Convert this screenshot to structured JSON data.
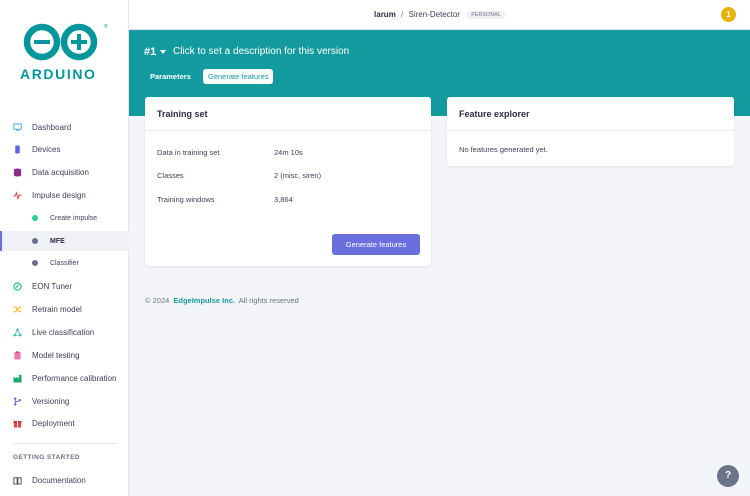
{
  "brand": {
    "wordmark": "ARDUINO",
    "reg": "®",
    "color": "#00979c"
  },
  "topbar": {
    "user": "larum",
    "separator": "/",
    "project": "Siren-Detector",
    "badge": "PERSONAL",
    "notification_count": "1"
  },
  "sidebar": {
    "items": [
      {
        "label": "Dashboard",
        "icon": "monitor-icon"
      },
      {
        "label": "Devices",
        "icon": "device-icon"
      },
      {
        "label": "Data acquisition",
        "icon": "database-icon"
      },
      {
        "label": "Impulse design",
        "icon": "pulse-icon"
      },
      {
        "label": "Create impulse",
        "icon": "dot-icon"
      },
      {
        "label": "MFE",
        "icon": "dot-icon",
        "active": true
      },
      {
        "label": "Classifier",
        "icon": "dot-icon"
      },
      {
        "label": "EON Tuner",
        "icon": "eon-icon"
      },
      {
        "label": "Retrain model",
        "icon": "shuffle-icon"
      },
      {
        "label": "Live classification",
        "icon": "network-icon"
      },
      {
        "label": "Model testing",
        "icon": "clipboard-icon"
      },
      {
        "label": "Performance calibration",
        "icon": "factory-icon"
      },
      {
        "label": "Versioning",
        "icon": "branch-icon"
      },
      {
        "label": "Deployment",
        "icon": "gift-icon"
      }
    ],
    "section_heading": "GETTING STARTED",
    "documentation": {
      "label": "Documentation",
      "icon": "book-icon"
    }
  },
  "header": {
    "version": "#1",
    "description": "Click to set a description for this version",
    "tabs": [
      "Parameters",
      "Generate features"
    ]
  },
  "training_set": {
    "title": "Training set",
    "rows": [
      {
        "key": "Data in training set",
        "value": "24m 10s"
      },
      {
        "key": "Classes",
        "value": "2 (misc, siren)"
      },
      {
        "key": "Training windows",
        "value": "3,864"
      }
    ],
    "button": "Generate features"
  },
  "feature_explorer": {
    "title": "Feature explorer",
    "empty_text": "No features generated yet."
  },
  "footer": {
    "copyright": "© 2024",
    "link": "EdgeImpulse Inc.",
    "rights": "All rights reserved"
  },
  "help": {
    "label": "?"
  },
  "colors": {
    "teal": "#139a9e",
    "primary_button": "#6b6fdd",
    "notification": "#e8b20a"
  }
}
